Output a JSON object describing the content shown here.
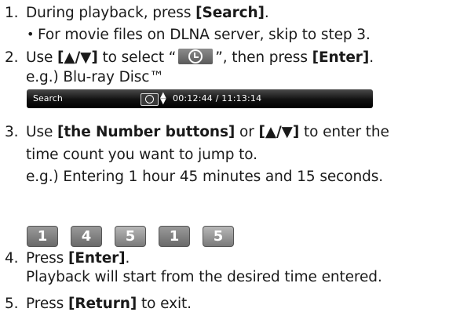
{
  "steps": [
    {
      "num": "1.",
      "pre": "During playback, press ",
      "bold": "[Search]",
      "post": "."
    },
    {
      "bullet": "•",
      "text": "For movie files on DLNA server, skip to step 3."
    },
    {
      "num": "2.",
      "pre": "Use ",
      "bold": "[▲/▼]",
      "mid": " to select “",
      "mid2": "”, then press ",
      "bold2": "[Enter]",
      "post": "."
    },
    {
      "example": "e.g.) Blu-ray Disc™"
    },
    {
      "num": "3.",
      "pre": "Use ",
      "bold": "[the Number buttons]",
      "mid": " or ",
      "bold2": "[▲/▼]",
      "post": " to enter the"
    },
    {
      "text": "time count you want to jump to."
    },
    {
      "example": "e.g.) Entering 1 hour 45 minutes and 15 seconds."
    },
    {
      "num": "4.",
      "pre": "Press ",
      "bold": "[Enter]",
      "post": "."
    },
    {
      "text": "Playback will start from the desired time entered."
    },
    {
      "num": "5.",
      "pre": "Press ",
      "bold": "[Return]",
      "post": " to exit."
    }
  ],
  "search_bar": {
    "label": "Search",
    "time": "00:12:44 / 11:13:14",
    "arrows": "▲▼",
    "icon": "clock-icon"
  },
  "number_keys": [
    "1",
    "4",
    "5",
    "1",
    "5"
  ]
}
